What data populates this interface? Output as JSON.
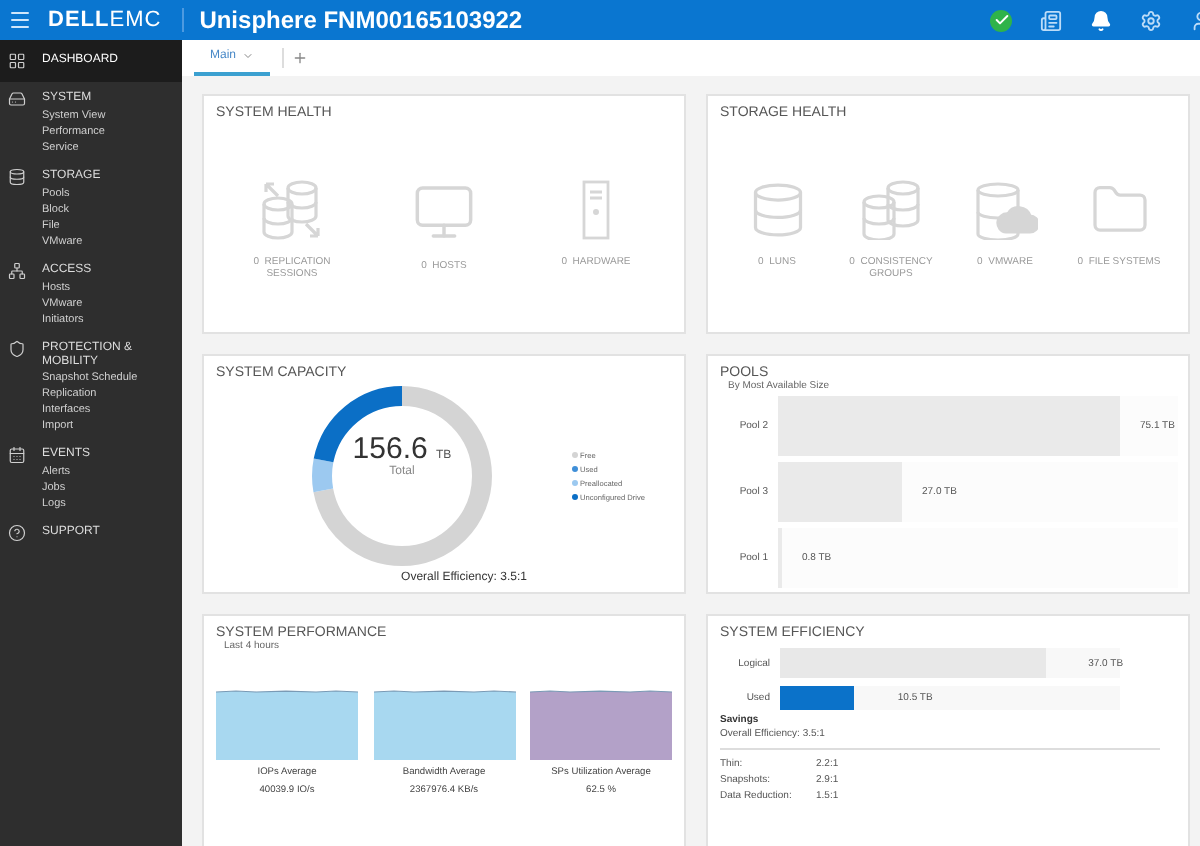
{
  "top_bar": {
    "logo": {
      "brand": "DELL",
      "product": "EMC"
    },
    "title": "Unisphere FNM00165103922"
  },
  "sidebar": {
    "sections": [
      {
        "label": "DASHBOARD",
        "selected": true
      },
      {
        "label": "SYSTEM",
        "selected": false,
        "items": [
          "System View",
          "Performance",
          "Service"
        ]
      },
      {
        "label": "STORAGE",
        "selected": false,
        "items": [
          "Pools",
          "Block",
          "File",
          "VMware"
        ]
      },
      {
        "label": "ACCESS",
        "selected": false,
        "items": [
          "Hosts",
          "VMware",
          "Initiators"
        ]
      },
      {
        "label": "PROTECTION & MOBILITY",
        "selected": false,
        "items": [
          "Snapshot Schedule",
          "Replication",
          "Interfaces",
          "Import"
        ]
      },
      {
        "label": "EVENTS",
        "selected": false,
        "items": [
          "Alerts",
          "Jobs",
          "Logs"
        ]
      },
      {
        "label": "SUPPORT",
        "selected": false
      }
    ]
  },
  "tabs": [
    {
      "label": "Main",
      "selected": true
    }
  ],
  "system_health": {
    "title": "SYSTEM HEALTH",
    "items": [
      {
        "count": "0",
        "label": "REPLICATION SESSIONS"
      },
      {
        "count": "0",
        "label": "HOSTS"
      },
      {
        "count": "0",
        "label": "HARDWARE"
      }
    ]
  },
  "storage_health": {
    "title": "STORAGE HEALTH",
    "items": [
      {
        "count": "0",
        "label": "LUNS"
      },
      {
        "count": "0",
        "label": "CONSISTENCY GROUPS"
      },
      {
        "count": "0",
        "label": "VMWARE"
      },
      {
        "count": "0",
        "label": "FILE SYSTEMS"
      }
    ]
  },
  "system_capacity": {
    "title": "SYSTEM CAPACITY",
    "total": "156.6",
    "unit": "TB",
    "total_label": "Total",
    "efficiency": "Overall Efficiency: 3.5:1",
    "legend": [
      {
        "label": "Free",
        "color": "#d4d4d4"
      },
      {
        "label": "Used",
        "color": "#3f8fd8"
      },
      {
        "label": "Preallocated",
        "color": "#9cc9f0"
      },
      {
        "label": "Unconfigured Drive",
        "color": "#0b6fc6"
      }
    ]
  },
  "pools": {
    "title": "POOLS",
    "subtitle": "By Most Available Size",
    "bars": [
      {
        "label": "Pool 2",
        "value": "75.1 TB",
        "level": 0.855
      },
      {
        "label": "Pool 3",
        "value": "27.0 TB",
        "level": 0.31
      },
      {
        "label": "Pool 1",
        "value": "0.8 TB",
        "level": 0.01
      }
    ]
  },
  "system_performance": {
    "title": "SYSTEM PERFORMANCE",
    "subtitle": "Last 4 hours",
    "metrics": [
      {
        "label": "IOPs Average",
        "value": "40039.9 IO/s",
        "color": "#a8d8f0"
      },
      {
        "label": "Bandwidth Average",
        "value": "2367976.4 KB/s",
        "color": "#a8d8f0"
      },
      {
        "label": "SPs Utilization Average",
        "value": "62.5 %",
        "color": "#b3a1c8"
      }
    ]
  },
  "system_efficiency": {
    "title": "SYSTEM EFFICIENCY",
    "bars": [
      {
        "label": "Logical",
        "value": "37.0 TB",
        "level": 0.78,
        "color": "#e8e8e8"
      },
      {
        "label": "Used",
        "value": "10.5 TB",
        "level": 0.22,
        "color": "#0b72c9"
      }
    ],
    "savings_title": "Savings",
    "overall": {
      "label": "Overall Efficiency:",
      "value": "3.5:1"
    },
    "ratios": [
      {
        "label": "Thin:",
        "value": "2.2:1"
      },
      {
        "label": "Snapshots:",
        "value": "2.9:1"
      },
      {
        "label": "Data Reduction:",
        "value": "1.5:1"
      }
    ]
  }
}
